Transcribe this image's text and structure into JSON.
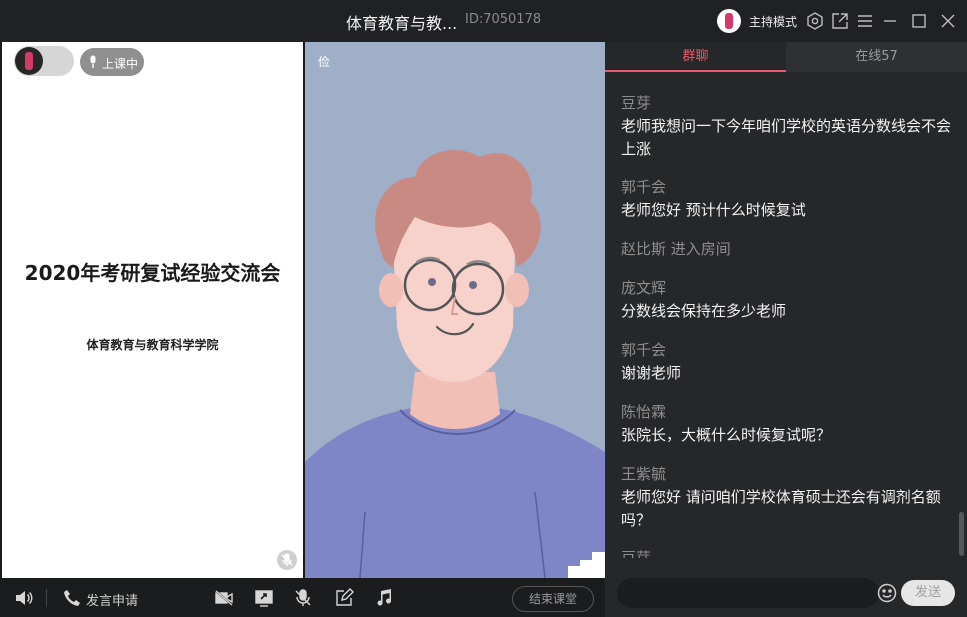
{
  "titlebar": {
    "title": "体育教育与教...",
    "room_id": "ID:7050178",
    "host_mode": "主持模式",
    "icons": [
      "settings-icon",
      "external-link-icon",
      "menu-icon",
      "minimize-icon",
      "maximize-icon",
      "close-icon"
    ]
  },
  "slide": {
    "title": "2020年考研复试经验交流会",
    "subtitle": "体育教育与教育科学学院",
    "status": "上课中"
  },
  "video": {
    "participant_name": "俭"
  },
  "chat": {
    "tabs": [
      {
        "label": "群聊",
        "active": true
      },
      {
        "label": "在线57",
        "active": false
      }
    ],
    "messages": [
      {
        "name": "豆芽",
        "text": "老师我想问一下今年咱们学校的英语分数线会不会上涨"
      },
      {
        "name": "郭千会",
        "text": "老师您好 预计什么时候复试"
      },
      {
        "system": "赵比斯 进入房间"
      },
      {
        "name": "庞文辉",
        "text": "分数线会保持在多少老师"
      },
      {
        "name": "郭千会",
        "text": "谢谢老师"
      },
      {
        "name": "陈怡霖",
        "text": "张院长，大概什么时候复试呢？"
      },
      {
        "name": "王紫毓",
        "text": "老师您好 请问咱们学校体育硕士还会有调剂名额吗？"
      },
      {
        "name": "豆芽",
        "text": ""
      }
    ],
    "input_placeholder": "",
    "send_label": "发送"
  },
  "toolbar": {
    "raise_hand_label": "发言申请",
    "end_class_label": "结束课堂"
  },
  "colors": {
    "accent": "#e85a6f",
    "background": "#1b1c1e",
    "video_bg": "#a0afc8"
  }
}
